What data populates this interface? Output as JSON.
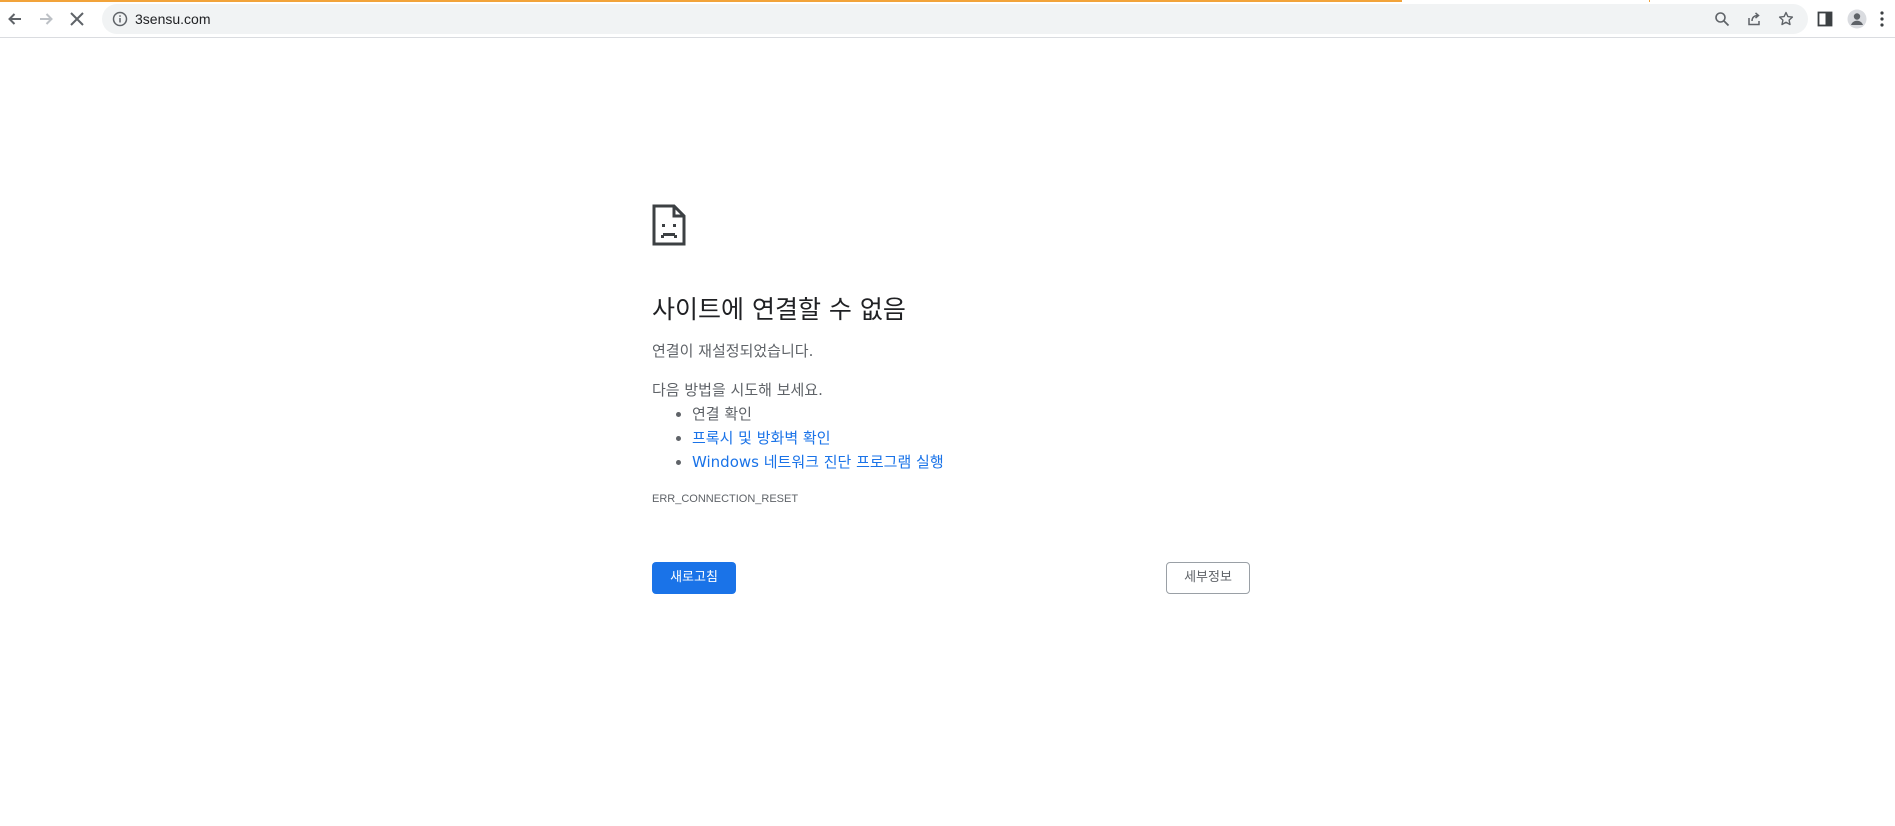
{
  "browser": {
    "url": "3sensu.com",
    "icons": {
      "back": "arrow-left-icon",
      "forward": "arrow-right-icon",
      "stop": "close-icon",
      "site_info": "info-icon",
      "zoom": "search-icon",
      "share": "share-icon",
      "bookmark": "star-icon",
      "side_panel": "side-panel-icon",
      "profile": "avatar-icon",
      "menu": "kebab-menu-icon"
    },
    "colors": {
      "loading_bar": "#f2a33a",
      "omnibox_bg": "#f1f3f4"
    }
  },
  "error_page": {
    "icon": "sad-document-icon",
    "title": "사이트에 연결할 수 없음",
    "subtitle": "연결이 재설정되었습니다.",
    "try_label": "다음 방법을 시도해 보세요.",
    "suggestions": [
      {
        "text": "연결 확인",
        "is_link": false
      },
      {
        "text": "프록시 및 방화벽 확인",
        "is_link": true
      },
      {
        "text": "Windows 네트워크 진단 프로그램 실행",
        "is_link": true
      }
    ],
    "error_code": "ERR_CONNECTION_RESET",
    "reload_label": "새로고침",
    "details_label": "세부정보",
    "colors": {
      "primary": "#1a73e8",
      "secondary_text": "#5f6368"
    }
  }
}
